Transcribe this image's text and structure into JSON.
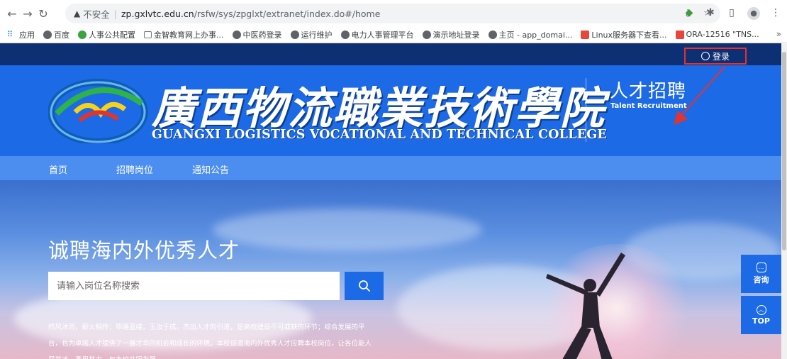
{
  "browser": {
    "insecure_label": "不安全",
    "url_host": "zp.gxlvtc.edu.cn",
    "url_path": "/rsfw/sys/zpglxt/extranet/index.do#/home",
    "bookmarks": [
      {
        "label": "应用",
        "icon": "apps-grid-icon"
      },
      {
        "label": "百度",
        "icon": "globe-icon"
      },
      {
        "label": "人事公共配置",
        "icon": "green-leaf-icon"
      },
      {
        "label": "金智教育网上办事...",
        "icon": "house-icon"
      },
      {
        "label": "中医药登录",
        "icon": "globe-icon"
      },
      {
        "label": "运行维护",
        "icon": "globe-icon"
      },
      {
        "label": "电力人事管理平台",
        "icon": "globe-icon"
      },
      {
        "label": "演示地址登录",
        "icon": "globe-icon"
      },
      {
        "label": "主页 - app_domai...",
        "icon": "globe-icon"
      },
      {
        "label": "Linux服务器下查看...",
        "icon": "red-c-icon"
      },
      {
        "label": "ORA-12516 \"TNS...",
        "icon": "red-c-icon"
      }
    ],
    "more": "»"
  },
  "header": {
    "login_label": "登录",
    "college_cn": "廣西物流職業技術學院",
    "college_en": "GUANGXI LOGISTICS VOCATIONAL AND TECHNICAL COLLEGE",
    "recruit_cn": "人才招聘",
    "recruit_en": "Talent Recruitment",
    "annotation": ""
  },
  "nav": {
    "items": [
      {
        "label": "首页",
        "active": true
      },
      {
        "label": "招聘岗位",
        "active": false
      },
      {
        "label": "通知公告",
        "active": false
      }
    ]
  },
  "hero": {
    "title": "诚聘海内外优秀人才",
    "search_placeholder": "请输入岗位名称搜索",
    "intro_lines": [
      "栉风沐雨，薪火相传；筚路蓝缕，玉汝于成。杰出人才的引进，是高校建设不可或缺的环节；综合发展的平",
      "台，也为卓越人才提供了一展才华的机会和成长的环境。本校诚邀海内外优秀人才应聘本校岗位，让各位能人",
      "尽其才，悉用其力，与本校共同发展。"
    ]
  },
  "float": {
    "consult_label": "咨询",
    "top_label": "TOP"
  },
  "colors": {
    "brand_blue": "#1d6ae6",
    "nav_blue": "#4c8ef0",
    "top_strip": "#0d2f73",
    "highlight_red": "#e5322d"
  }
}
